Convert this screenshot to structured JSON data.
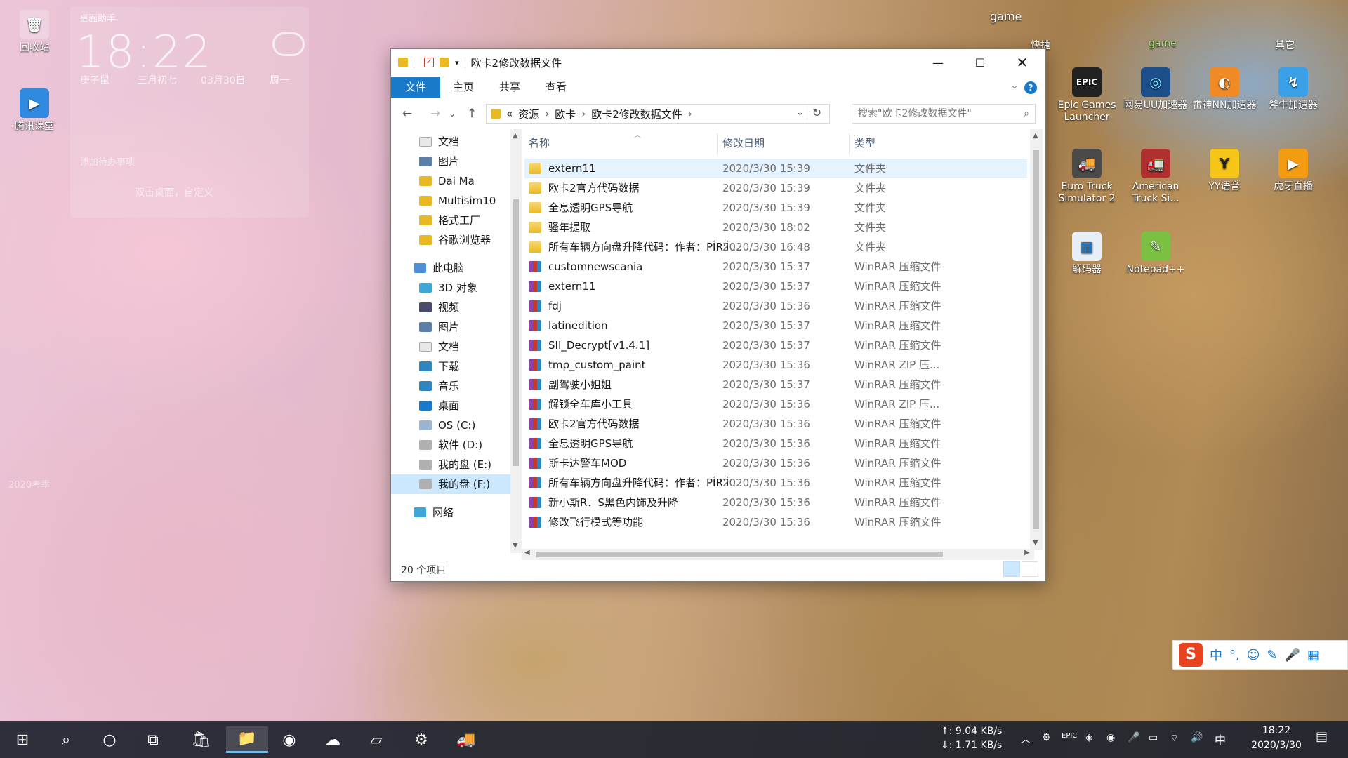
{
  "desktop": {
    "icons_left": [
      {
        "label": "回收站",
        "glyph": "🗑"
      },
      {
        "label": "腾讯课堂",
        "glyph": "▶"
      }
    ],
    "icons_right": [
      {
        "label": "Epic Games Launcher",
        "glyph": "EPIC"
      },
      {
        "label": "网易UU加速器",
        "glyph": "◎"
      },
      {
        "label": "雷神NN加速器",
        "glyph": "◐"
      },
      {
        "label": "斧牛加速器",
        "glyph": "↯"
      },
      {
        "label": "Euro Truck Simulator 2",
        "glyph": "🚚"
      },
      {
        "label": "American Truck Si...",
        "glyph": "🚛"
      },
      {
        "label": "YY语音",
        "glyph": "Y"
      },
      {
        "label": "虎牙直播",
        "glyph": "▶"
      },
      {
        "label": "解码器",
        "glyph": "▦"
      },
      {
        "label": "Notepad++",
        "glyph": "✎"
      }
    ],
    "top_labels": {
      "game": "game",
      "kuaijie": "快捷",
      "game2": "game",
      "qita": "其它"
    },
    "widget": {
      "title": "桌面助手",
      "time": "18:22",
      "date_parts": [
        "庚子鼠",
        "三月初七",
        "03月30日",
        "周一"
      ],
      "add_text": "添加待办事项",
      "search_text": "双击桌面，自定义",
      "bottom_text": "2020考季"
    }
  },
  "window": {
    "title": "欧卡2修改数据文件",
    "ribbon_tabs": [
      "文件",
      "主页",
      "共享",
      "查看"
    ],
    "breadcrumb": [
      "«",
      "资源",
      "欧卡",
      "欧卡2修改数据文件"
    ],
    "search_placeholder": "搜索\"欧卡2修改数据文件\"",
    "columns": {
      "name": "名称",
      "date": "修改日期",
      "type": "类型"
    },
    "nav_items": [
      {
        "label": "文档",
        "pinned": true,
        "color": "#e8e8e8"
      },
      {
        "label": "图片",
        "pinned": true,
        "color": "#5d7ea8"
      },
      {
        "label": "Dai   Ma",
        "pinned": false,
        "color": "#e8b923"
      },
      {
        "label": "Multisim10",
        "pinned": false,
        "color": "#e8b923"
      },
      {
        "label": "格式工厂",
        "pinned": false,
        "color": "#e8b923"
      },
      {
        "label": "谷歌浏览器",
        "pinned": false,
        "color": "#e8b923"
      },
      {
        "label": "此电脑",
        "pinned": false,
        "color": "#4f8fd9"
      },
      {
        "label": "3D 对象",
        "pinned": false,
        "color": "#3fa6d8"
      },
      {
        "label": "视频",
        "pinned": false,
        "color": "#4a4a6a"
      },
      {
        "label": "图片",
        "pinned": false,
        "color": "#5d7ea8"
      },
      {
        "label": "文档",
        "pinned": false,
        "color": "#e8e8e8"
      },
      {
        "label": "下载",
        "pinned": false,
        "color": "#2e86c1"
      },
      {
        "label": "音乐",
        "pinned": false,
        "color": "#2e86c1"
      },
      {
        "label": "桌面",
        "pinned": false,
        "color": "#1979ca"
      },
      {
        "label": "OS (C:)",
        "pinned": false,
        "color": "#9bb5cf"
      },
      {
        "label": "软件 (D:)",
        "pinned": false,
        "color": "#b0b0b0"
      },
      {
        "label": "我的盘 (E:)",
        "pinned": false,
        "color": "#b0b0b0"
      },
      {
        "label": "我的盘 (F:)",
        "pinned": false,
        "color": "#b0b0b0"
      },
      {
        "label": "网络",
        "pinned": false,
        "color": "#3fa6d8"
      }
    ],
    "files": [
      {
        "name": "extern11",
        "date": "2020/3/30 15:39",
        "type": "文件夹",
        "kind": "folder"
      },
      {
        "name": "欧卡2官方代码数据",
        "date": "2020/3/30 15:39",
        "type": "文件夹",
        "kind": "folder"
      },
      {
        "name": "全息透明GPS导航",
        "date": "2020/3/30 15:39",
        "type": "文件夹",
        "kind": "folder"
      },
      {
        "name": "骚年提取",
        "date": "2020/3/30 18:02",
        "type": "文件夹",
        "kind": "folder"
      },
      {
        "name": "所有车辆方向盘升降代码：作者：PİR'İ ...",
        "date": "2020/3/30 16:48",
        "type": "文件夹",
        "kind": "folder"
      },
      {
        "name": "customnewscania",
        "date": "2020/3/30 15:37",
        "type": "WinRAR 压缩文件",
        "kind": "rar"
      },
      {
        "name": "extern11",
        "date": "2020/3/30 15:37",
        "type": "WinRAR 压缩文件",
        "kind": "rar"
      },
      {
        "name": "fdj",
        "date": "2020/3/30 15:36",
        "type": "WinRAR 压缩文件",
        "kind": "rar"
      },
      {
        "name": "latinedition",
        "date": "2020/3/30 15:37",
        "type": "WinRAR 压缩文件",
        "kind": "rar"
      },
      {
        "name": "SII_Decrypt[v1.4.1]",
        "date": "2020/3/30 15:37",
        "type": "WinRAR 压缩文件",
        "kind": "rar"
      },
      {
        "name": "tmp_custom_paint",
        "date": "2020/3/30 15:36",
        "type": "WinRAR ZIP 压...",
        "kind": "rar"
      },
      {
        "name": "副驾驶小姐姐",
        "date": "2020/3/30 15:37",
        "type": "WinRAR 压缩文件",
        "kind": "rar"
      },
      {
        "name": "解锁全车库小工具",
        "date": "2020/3/30 15:36",
        "type": "WinRAR ZIP 压...",
        "kind": "rar"
      },
      {
        "name": "欧卡2官方代码数据",
        "date": "2020/3/30 15:36",
        "type": "WinRAR 压缩文件",
        "kind": "rar"
      },
      {
        "name": "全息透明GPS导航",
        "date": "2020/3/30 15:36",
        "type": "WinRAR 压缩文件",
        "kind": "rar"
      },
      {
        "name": "斯卡达警车MOD",
        "date": "2020/3/30 15:36",
        "type": "WinRAR 压缩文件",
        "kind": "rar"
      },
      {
        "name": "所有车辆方向盘升降代码：作者：PİR'İ ...",
        "date": "2020/3/30 15:36",
        "type": "WinRAR 压缩文件",
        "kind": "rar"
      },
      {
        "name": "新小斯R．S黑色内饰及升降",
        "date": "2020/3/30 15:36",
        "type": "WinRAR 压缩文件",
        "kind": "rar"
      },
      {
        "name": "修改飞行模式等功能",
        "date": "2020/3/30 15:36",
        "type": "WinRAR 压缩文件",
        "kind": "rar"
      }
    ],
    "status": "20 个项目"
  },
  "taskbar": {
    "net_up": "↑: 9.04 KB/s",
    "net_down": "↓: 1.71 KB/s",
    "ime_lang": "中",
    "clock_time": "18:22",
    "clock_date": "2020/3/30"
  },
  "ime_bar": {
    "logo": "S",
    "items": [
      "中",
      "°,",
      "☺",
      "✎",
      "🎤",
      "▦"
    ]
  }
}
